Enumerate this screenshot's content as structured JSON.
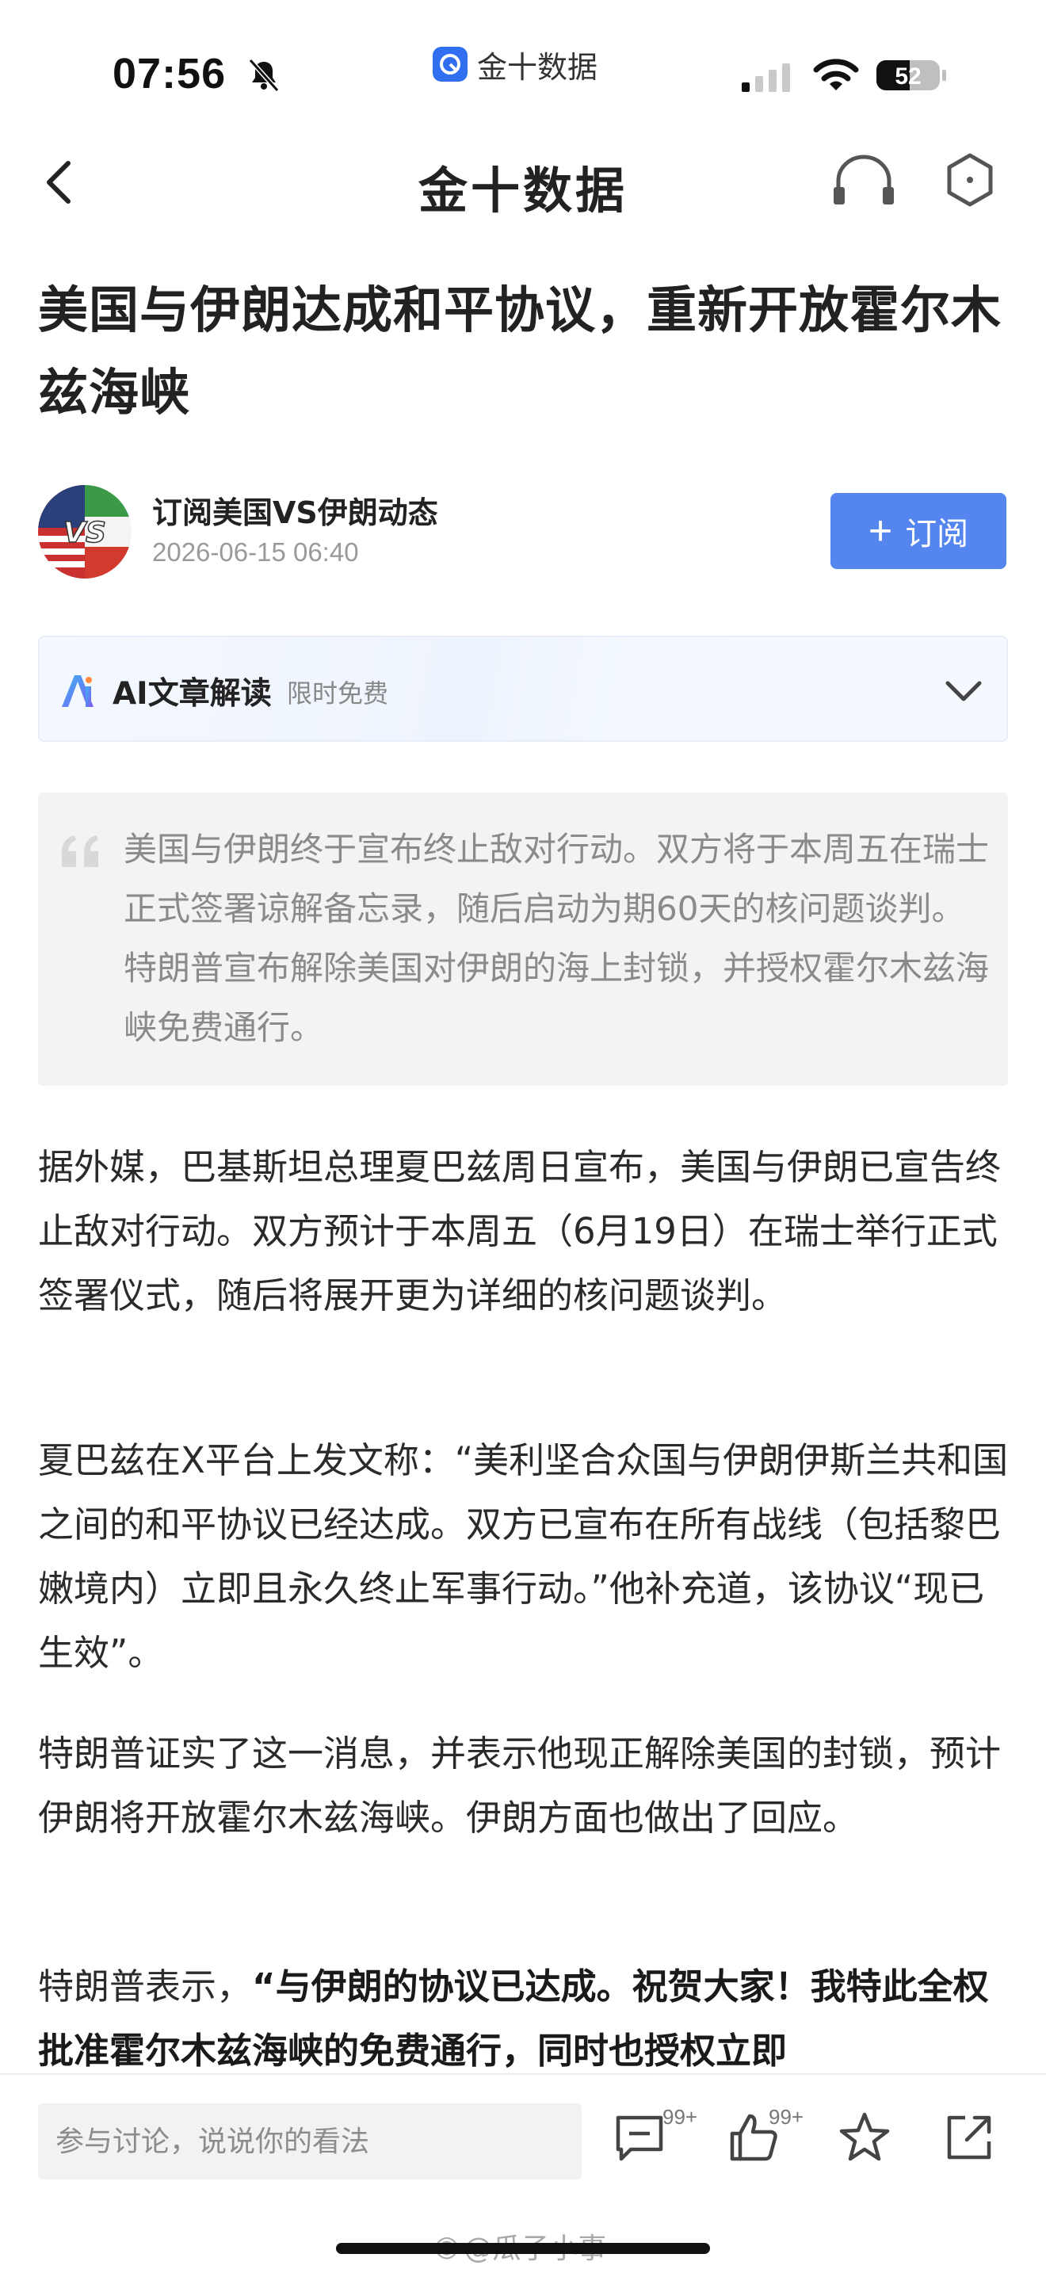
{
  "status_bar": {
    "time": "07:56",
    "app_name": "金十数据",
    "battery": "52",
    "icons": [
      "bell-muted-icon",
      "cellular-signal-icon",
      "wifi-icon",
      "battery-icon"
    ]
  },
  "nav": {
    "title": "金十数据",
    "icons": [
      "back-arrow-icon",
      "headset-icon",
      "hexagon-icon"
    ]
  },
  "article": {
    "headline": "美国与伊朗达成和平协议，重新开放霍尔木兹海峡",
    "author": {
      "name": "订阅美国VS伊朗动态",
      "date": "2026-06-15 06:40",
      "avatar_text": "VS"
    },
    "subscribe_label": "订阅",
    "ai_card": {
      "title": "AI文章解读",
      "badge": "限时免费"
    },
    "summary": "美国与伊朗终于宣布终止敌对行动。双方将于本周五在瑞士正式签署谅解备忘录，随后启动为期60天的核问题谈判。特朗普宣布解除美国对伊朗的海上封锁，并授权霍尔木兹海峡免费通行。",
    "paragraphs": [
      "据外媒，巴基斯坦总理夏巴兹周日宣布，美国与伊朗已宣告终止敌对行动。双方预计于本周五（6月19日）在瑞士举行正式签署仪式，随后将展开更为详细的核问题谈判。",
      "夏巴兹在X平台上发文称：“美利坚合众国与伊朗伊斯兰共和国之间的和平协议已经达成。双方已宣布在所有战线（包括黎巴嫩境内）立即且永久终止军事行动。”他补充道，该协议“现已生效”。",
      "特朗普证实了这一消息，并表示他现正解除美国的封锁，预计伊朗将开放霍尔木兹海峡。伊朗方面也做出了回应。"
    ],
    "para4": {
      "lead": "特朗普表示，",
      "bold": "“与伊朗的协议已达成。祝贺大家！我特此全权批准霍尔木兹海峡的免费通行，同时也授权立即"
    }
  },
  "bottom_bar": {
    "comment_placeholder": "参与讨论，说说你的看法",
    "comment_count": "99+",
    "like_count": "99+",
    "watermark": "@瓜子小事"
  },
  "colors": {
    "accent": "#5585ee",
    "text": "#222222",
    "muted": "#9a9a9a",
    "quote_bg": "#f3f3f3"
  }
}
